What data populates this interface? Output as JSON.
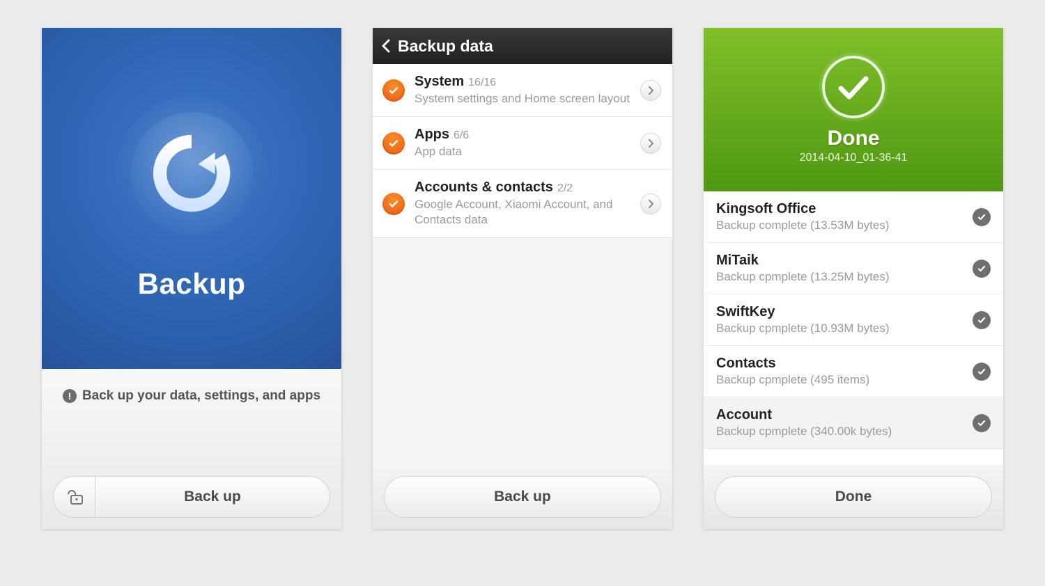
{
  "screen1": {
    "title": "Backup",
    "message": "Back up your data, settings, and apps",
    "lock_icon": "unlock-icon",
    "button": "Back up"
  },
  "screen2": {
    "header_title": "Backup data",
    "items": [
      {
        "name": "System",
        "count": "16/16",
        "desc": "System settings and Home screen layout"
      },
      {
        "name": "Apps",
        "count": "6/6",
        "desc": "App data"
      },
      {
        "name": "Accounts & contacts",
        "count": "2/2",
        "desc": "Google Account, Xiaomi Account, and Contacts data"
      }
    ],
    "button": "Back up"
  },
  "screen3": {
    "done_label": "Done",
    "timestamp": "2014-04-10_01-36-41",
    "items": [
      {
        "name": "Kingsoft Office",
        "desc": "Backup complete (13.53M bytes)"
      },
      {
        "name": "MiTaik",
        "desc": "Backup cpmplete (13.25M bytes)"
      },
      {
        "name": "SwiftKey",
        "desc": "Backup cpmplete (10.93M bytes)"
      },
      {
        "name": "Contacts",
        "desc": "Backup cpmplete (495 items)"
      },
      {
        "name": "Account",
        "desc": "Backup cpmplete (340.00k bytes)"
      }
    ],
    "button": "Done"
  }
}
